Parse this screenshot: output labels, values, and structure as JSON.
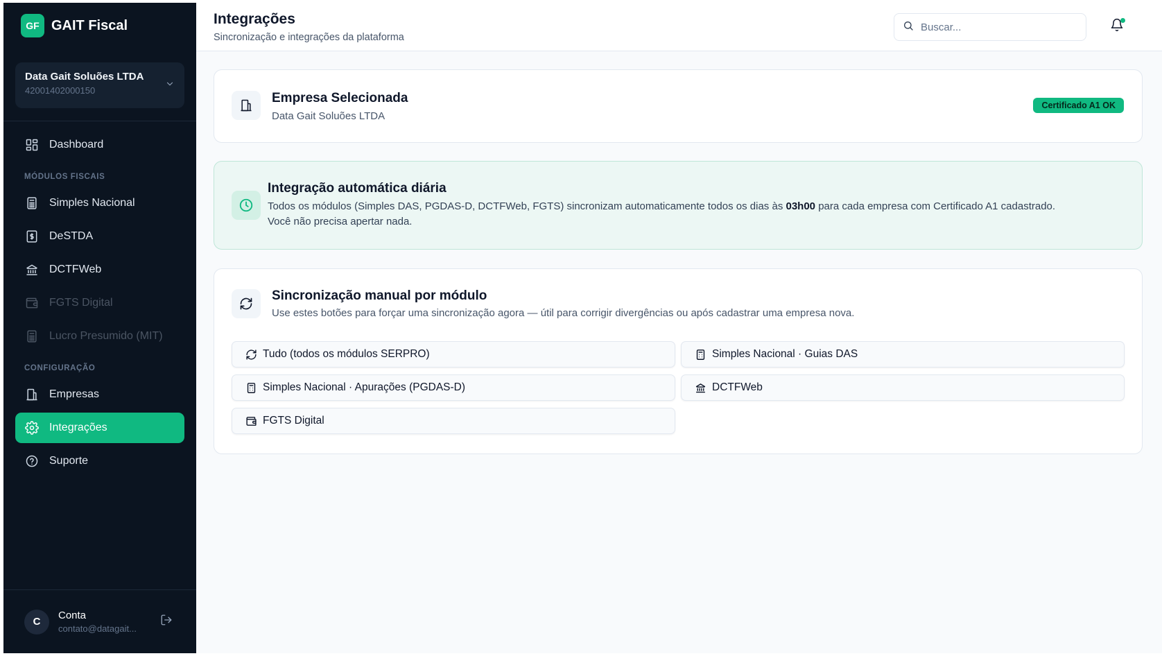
{
  "brand": {
    "logo": "GF",
    "name": "GAIT Fiscal"
  },
  "company_selector": {
    "name": "Data Gait Soluões LTDA",
    "cnpj": "42001402000150",
    "icon": "chevron-down-icon"
  },
  "sidebar": {
    "dashboard": {
      "label": "Dashboard",
      "icon": "dashboard-icon"
    },
    "section_fiscal": "MÓDULOS FISCAIS",
    "simples": {
      "label": "Simples Nacional",
      "icon": "calculator-icon"
    },
    "destda": {
      "label": "DeSTDA",
      "icon": "receipt-dollar-icon"
    },
    "dctfweb": {
      "label": "DCTFWeb",
      "icon": "bank-icon"
    },
    "fgts": {
      "label": "FGTS Digital",
      "icon": "wallet-icon",
      "disabled": true
    },
    "lucro": {
      "label": "Lucro Presumido (MIT)",
      "icon": "calculator-icon",
      "disabled": true
    },
    "section_config": "CONFIGURAÇÃO",
    "empresas": {
      "label": "Empresas",
      "icon": "building-icon"
    },
    "integracoes": {
      "label": "Integrações",
      "icon": "gear-icon",
      "active": true
    },
    "suporte": {
      "label": "Suporte",
      "icon": "help-circle-icon"
    }
  },
  "account": {
    "initial": "C",
    "name": "Conta",
    "email": "contato@datagait...",
    "logout_icon": "logout-icon"
  },
  "header": {
    "title": "Integrações",
    "subtitle": "Sincronização e integrações da plataforma"
  },
  "search": {
    "placeholder": "Buscar...",
    "value": ""
  },
  "notification": {
    "icon": "bell-icon",
    "has_unread": true
  },
  "selected_company": {
    "title": "Empresa Selecionada",
    "name": "Data Gait Soluões LTDA",
    "badge": "Certificado A1 OK",
    "icon": "building-icon"
  },
  "auto_sync": {
    "title": "Integração automática diária",
    "text_before": "Todos os módulos (Simples DAS, PGDAS-D, DCTFWeb, FGTS) sincronizam automaticamente todos os dias às ",
    "time": "03h00",
    "text_after": " para cada empresa com Certificado A1 cadastrado.",
    "line2": "Você não precisa apertar nada.",
    "icon": "clock-icon"
  },
  "manual_sync": {
    "title": "Sincronização manual por módulo",
    "subtitle": "Use estes botões para forçar uma sincronização agora — útil para corrigir divergências ou após cadastrar uma empresa nova.",
    "icon": "refresh-icon",
    "buttons": {
      "all": {
        "label": "Tudo (todos os módulos SERPRO)",
        "icon": "refresh-icon"
      },
      "simples_das": {
        "label": "Simples Nacional · Guias DAS",
        "icon": "calculator-icon"
      },
      "pgdas": {
        "label": "Simples Nacional · Apurações (PGDAS-D)",
        "icon": "calculator-icon"
      },
      "dctfweb": {
        "label": "DCTFWeb",
        "icon": "bank-icon"
      },
      "fgts": {
        "label": "FGTS Digital",
        "icon": "wallet-icon"
      }
    }
  },
  "colors": {
    "accent": "#10b981",
    "sidebar_bg": "#0b1420",
    "page_bg": "#f8fafc"
  }
}
